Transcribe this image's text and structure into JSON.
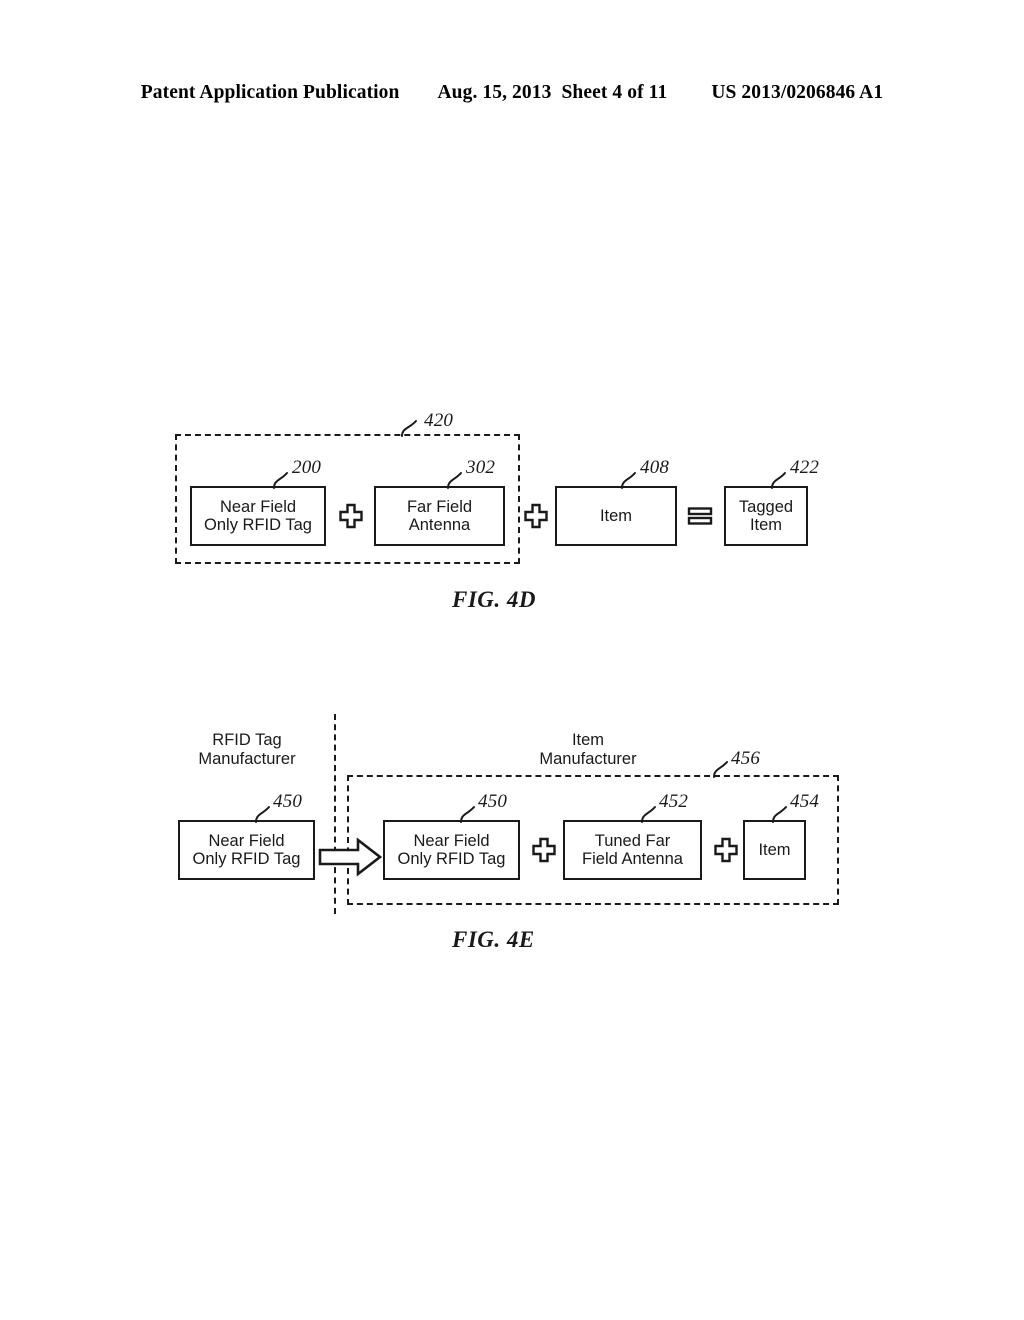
{
  "header": {
    "publication": "Patent Application Publication",
    "date": "Aug. 15, 2013",
    "sheet": "Sheet 4 of 11",
    "document_number": "US 2013/0206846 A1"
  },
  "figures": [
    {
      "caption": "FIG. 4D",
      "group_ref": "420",
      "nodes": [
        {
          "ref": "200",
          "line1": "Near Field",
          "line2": "Only RFID Tag"
        },
        {
          "ref": "302",
          "line1": "Far Field",
          "line2": "Antenna"
        },
        {
          "ref": "408",
          "line1": "Item",
          "line2": ""
        },
        {
          "ref": "422",
          "line1": "Tagged",
          "line2": "Item"
        }
      ],
      "operators": [
        "plus",
        "plus",
        "equals"
      ]
    },
    {
      "caption": "FIG. 4E",
      "group_ref": "456",
      "lanes": [
        {
          "line1": "RFID Tag",
          "line2": "Manufacturer"
        },
        {
          "line1": "Item",
          "line2": "Manufacturer"
        }
      ],
      "nodes": [
        {
          "ref": "450",
          "line1": "Near Field",
          "line2": "Only RFID Tag"
        },
        {
          "ref": "450",
          "line1": "Near Field",
          "line2": "Only RFID Tag"
        },
        {
          "ref": "452",
          "line1": "Tuned Far",
          "line2": "Field Antenna"
        },
        {
          "ref": "454",
          "line1": "Item",
          "line2": ""
        }
      ],
      "operators": [
        "arrow-right",
        "plus",
        "plus"
      ]
    }
  ]
}
